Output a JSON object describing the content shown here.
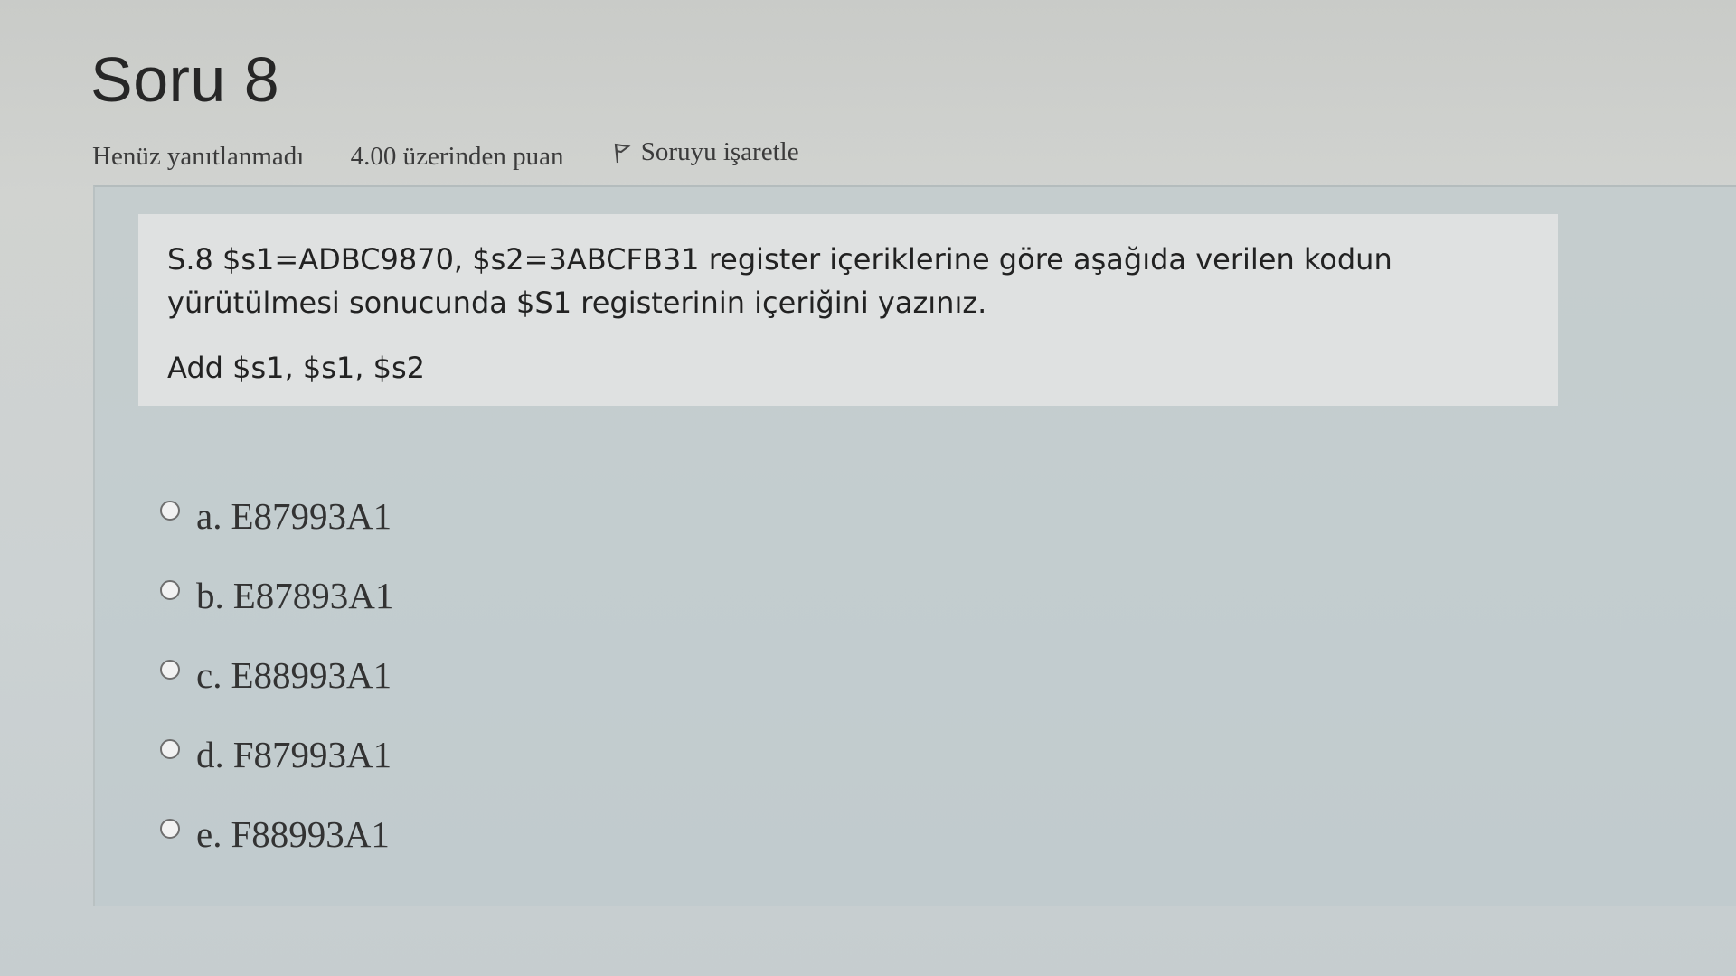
{
  "question": {
    "title": "Soru 8",
    "status": "Henüz yanıtlanmadı",
    "grade": "4.00 üzerinden puan",
    "flag_label": "Soruyu işaretle",
    "text": "S.8 $s1=ADBC9870, $s2=3ABCFB31 register içeriklerine göre aşağıda verilen kodun yürütülmesi sonucunda $S1 registerinin içeriğini yazınız.",
    "code": "Add $s1, $s1, $s2"
  },
  "answers": [
    {
      "letter": "a.",
      "value": "E87993A1"
    },
    {
      "letter": "b.",
      "value": "E87893A1"
    },
    {
      "letter": "c.",
      "value": "E88993A1"
    },
    {
      "letter": "d.",
      "value": "F87993A1"
    },
    {
      "letter": "e.",
      "value": "F88993A1"
    }
  ],
  "icons": {
    "flag": "flag-icon",
    "radio": "radio-button"
  },
  "colors": {
    "content_bg": "#bbc9cc",
    "question_box_bg": "#e2e4e4"
  }
}
